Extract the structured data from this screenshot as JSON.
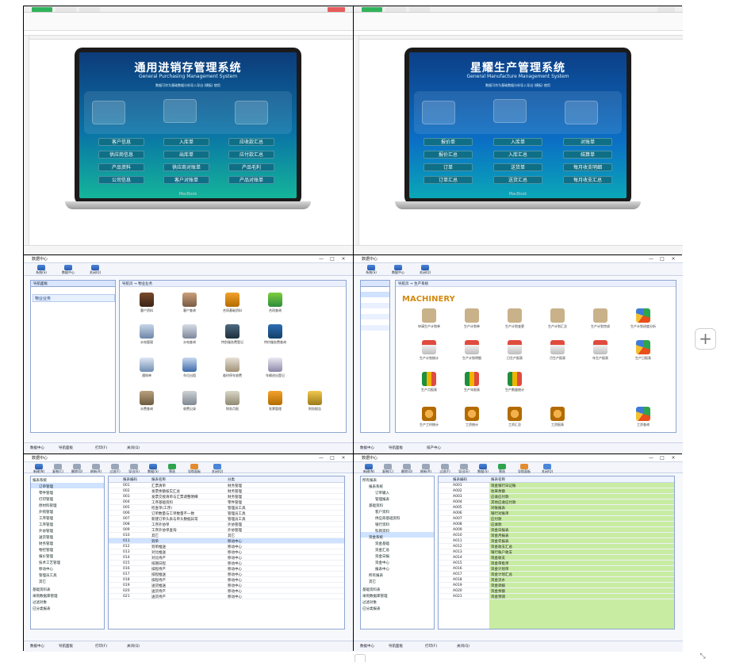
{
  "ui": {
    "zoom_button_label": "+",
    "corner_icon": "resize-corner-icon"
  },
  "panels": [
    {
      "kind": "excel",
      "laptop_title": "通用进销存管理系统",
      "laptop_subtitle": "General Purchasing Management System",
      "laptop_note": "数据可作为基础数据分析导入导出 (模板) 使用",
      "brand": "MacBook",
      "buttons": [
        "客户信息",
        "入库单",
        "应收款汇总",
        "供应商信息",
        "出库单",
        "应付款汇总",
        "产品资料",
        "供应商对账单",
        "产品毛利",
        "公司信息",
        "客户对账单",
        "产品对账单"
      ]
    },
    {
      "kind": "excel",
      "laptop_title": "星耀生产管理系统",
      "laptop_subtitle": "General Manufacture Management System",
      "laptop_note": "数据可作为基础数据分析导入导出 (模板) 使用",
      "brand": "MacBook",
      "buttons": [
        "报价单",
        "入库单",
        "对账单",
        "报价汇总",
        "入库汇总",
        "结算单",
        "订单",
        "送货单",
        "每月收支明细",
        "订单汇总",
        "送货汇总",
        "每月收支汇总"
      ]
    },
    {
      "kind": "app_icons",
      "window_title": "数据中心",
      "toolbar": [
        "系统(S)",
        "数据中心",
        "关闭(Q)"
      ],
      "nav_title": "导航面板",
      "nav_selected": "物业业务",
      "crumb": "导航页 → 物业业务",
      "icons": [
        "客户资料",
        "客户查询",
        "合同基础资料",
        "合同查询",
        "水电管理",
        "水电查询",
        "特别服务费登记",
        "特约服务费查询",
        "通知单",
        "车位出租",
        "临时停车收费",
        "车辆进出登记",
        "水费查询",
        "收费记录",
        "财务月报",
        "发票管理",
        "财务报告"
      ],
      "status": [
        "数据中心",
        "导航面板",
        "打印(F)",
        "关闭(Q)"
      ]
    },
    {
      "kind": "app_icons2",
      "window_title": "数据中心",
      "toolbar": [
        "系统(S)",
        "数据中心",
        "关闭(Q)"
      ],
      "crumb": "导航页 → 生产系统",
      "logo": "MACHINERY",
      "icons": [
        "申请生产计划单",
        "生产计划单",
        "生产计划变更",
        "生产计划汇总",
        "生产计划完成",
        "生产计划进度分析",
        "生产计划统计",
        "生产计划明细",
        "日生产报表",
        "月生产报表",
        "年生产报表",
        "生产日报表",
        "生产月报表",
        "生产年报表",
        "生产数量统计",
        "生产工时统计",
        "工资统计",
        "工资汇总",
        "工资报表",
        "工资查询"
      ],
      "status": [
        "数据中心",
        "导航面板",
        "排产中心"
      ]
    },
    {
      "kind": "tree_table",
      "window_title": "数据中心",
      "toolbar": [
        "新建(N)",
        "复制(C)",
        "删除(D)",
        "刷新(R)",
        "过滤(F)",
        "导出(E)",
        "数据(S)",
        "筛选",
        "导航面板",
        "关闭(Q)"
      ],
      "tree": [
        "报表系统",
        "订单管理",
        "零件管理",
        "打印管理",
        "原材料管理",
        "外购管理",
        "工序管理",
        "工序管理",
        "外协管理",
        "送货管理",
        "财务管理",
        "物控管理",
        "报价管理",
        "技术工艺管理",
        "移动中心",
        "管理员工具",
        "其它",
        "基础资料表",
        "采购数据库管理",
        "过滤对象",
        "已分类报表"
      ],
      "columns": [
        "报表编码",
        "报表名称",
        "分类"
      ],
      "rows": [
        [
          "001",
          "汇票清单",
          "财务管理"
        ],
        [
          "002",
          "发票余额核实汇总",
          "财务管理"
        ],
        [
          "003",
          "发票交接清单与汇票调整明细",
          "财务管理"
        ],
        [
          "004",
          "工序基础资料",
          "零件管理"
        ],
        [
          "005",
          "检查单(工序)",
          "管理员工具"
        ],
        [
          "006",
          "订单数量与工单数量不一致",
          "管理员工具"
        ],
        [
          "007",
          "新建订单头表与单头数据异常",
          "管理员工具"
        ],
        [
          "008",
          "工序外协单",
          "外协管理"
        ],
        [
          "009",
          "工序外协单查询",
          "外协管理"
        ],
        [
          "010",
          "其它",
          "其它"
        ],
        [
          "011",
          "到单",
          "移动中心"
        ],
        [
          "012",
          "到单推送",
          "移动中心"
        ],
        [
          "013",
          "对比推送",
          "移动中心"
        ],
        [
          "014",
          "对比待产",
          "移动中心"
        ],
        [
          "015",
          "排期日程",
          "移动中心"
        ],
        [
          "016",
          "排程待产",
          "移动中心"
        ],
        [
          "017",
          "排程推送",
          "移动中心"
        ],
        [
          "018",
          "排程待产",
          "移动中心"
        ],
        [
          "019",
          "送货推送",
          "移动中心"
        ],
        [
          "020",
          "送货待产",
          "移动中心"
        ],
        [
          "021",
          "送货待产",
          "移动中心"
        ]
      ],
      "status": [
        "数据中心",
        "导航面板",
        "打印(F)",
        "关闭(Q)"
      ]
    },
    {
      "kind": "tree_table_green",
      "window_title": "数据中心",
      "toolbar": [
        "新建(N)",
        "复制(C)",
        "删除(D)",
        "刷新(R)",
        "过滤(F)",
        "导出(E)",
        "数据(S)",
        "筛选",
        "导航面板",
        "关闭(Q)"
      ],
      "tree": [
        "所有报表",
        "报表系统",
        "订单输入",
        "管理报表",
        "基础资料",
        "客户资料",
        "供应商基础资料",
        "银行资料",
        "科目资料",
        "资金系统",
        "资金基础",
        "资金汇总",
        "资金日报",
        "资金中心",
        "报表中心",
        "所有报表",
        "其它",
        "基础资料表",
        "采购数据库管理",
        "过滤对象",
        "已分类报表"
      ],
      "columns": [
        "报表编码",
        "报表名称"
      ],
      "rows": [
        [
          "A001",
          "现金银行日记账"
        ],
        [
          "A002",
          "往来余额"
        ],
        [
          "A003",
          "应收应付款"
        ],
        [
          "A004",
          "其他应收应付款"
        ],
        [
          "A005",
          "对账报表"
        ],
        [
          "A006",
          "银行对账单"
        ],
        [
          "A007",
          "应付款"
        ],
        [
          "A008",
          "应收款"
        ],
        [
          "A009",
          "资金日报表"
        ],
        [
          "A010",
          "资金月报表"
        ],
        [
          "A011",
          "资金年报表"
        ],
        [
          "A012",
          "资金收支汇总"
        ],
        [
          "A013",
          "银行账户收支"
        ],
        [
          "A014",
          "现金收支"
        ],
        [
          "A015",
          "资金审批单"
        ],
        [
          "A016",
          "资金计划单"
        ],
        [
          "A017",
          "资金计划汇总"
        ],
        [
          "A018",
          "资金流水"
        ],
        [
          "A019",
          "资金调拨"
        ],
        [
          "A020",
          "资金余额"
        ],
        [
          "A021",
          "资金预测"
        ]
      ],
      "status": [
        "数据中心",
        "导航面板",
        "打印(F)",
        "关闭(Q)"
      ]
    }
  ]
}
